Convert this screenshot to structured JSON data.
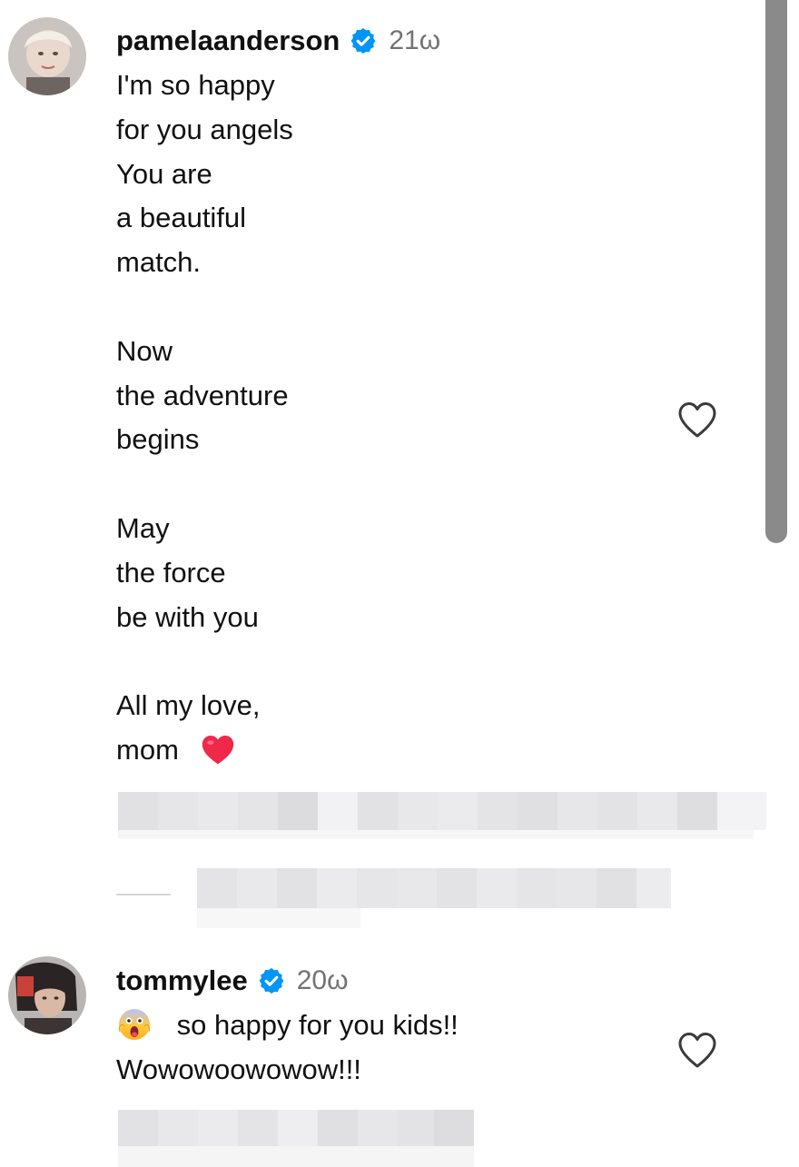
{
  "comments": [
    {
      "username": "pamelaanderson",
      "timestamp": "21ω",
      "verified_icon": "verified-badge-icon",
      "lines": [
        "I'm so happy",
        "for you angels",
        "You are",
        "a beautiful",
        "match.",
        "",
        "Now",
        "the adventure",
        "begins",
        "",
        "May",
        "the force",
        "be with you",
        "",
        "All my love,",
        "mom"
      ],
      "trailing_emoji": "red-heart-emoji",
      "like_icon": "heart-outline-icon"
    },
    {
      "username": "tommylee",
      "timestamp": "20ω",
      "verified_icon": "verified-badge-icon",
      "leading_emoji": "screaming-face-emoji",
      "lines": [
        "so happy for you kids!!",
        "Wowowoowowow!!!"
      ],
      "like_icon": "heart-outline-icon"
    }
  ],
  "colors": {
    "verified_blue": "#0095f6",
    "timestamp_gray": "#737373",
    "heart_red": "#f0284a",
    "pixelated_gray": "#e3e3e5"
  }
}
